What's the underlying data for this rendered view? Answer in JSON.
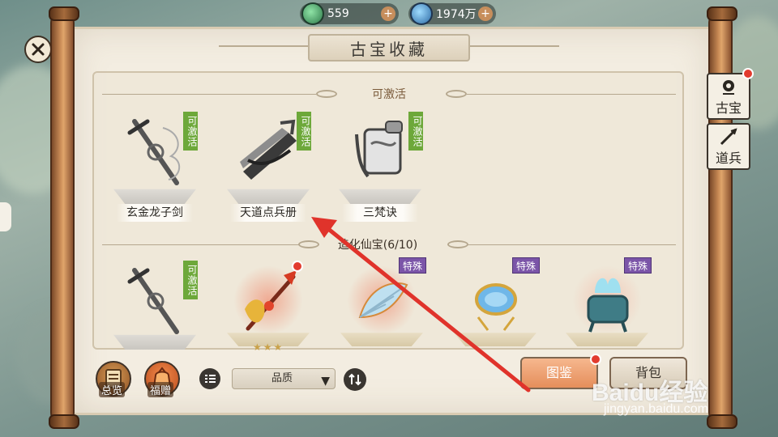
{
  "currency": {
    "jade": {
      "value": "559",
      "icon": "jade-coin-icon"
    },
    "spirit": {
      "value": "1974万",
      "icon": "spirit-stone-icon"
    }
  },
  "panel": {
    "title": "古宝收藏"
  },
  "sections": {
    "activatable": {
      "title": "可激活",
      "items": [
        {
          "name": "玄金龙子剑",
          "tag": "可激活"
        },
        {
          "name": "天道点兵册",
          "tag": "可激活"
        },
        {
          "name": "三梵诀",
          "tag": "可激活"
        }
      ]
    },
    "creation": {
      "title": "造化仙宝(6/10)",
      "items": [
        {
          "tag": "可激活",
          "tag_type": "activatable"
        },
        {
          "tag": "",
          "tag_type": "none",
          "red_dot": true,
          "stars": "★★★"
        },
        {
          "tag": "特殊",
          "tag_type": "special"
        },
        {
          "tag": "特殊",
          "tag_type": "special"
        },
        {
          "tag": "特殊",
          "tag_type": "special"
        }
      ]
    }
  },
  "side_tabs": [
    {
      "label": "古宝",
      "icon": "treasure-icon",
      "red_dot": true,
      "active": true
    },
    {
      "label": "道兵",
      "icon": "weapon-icon",
      "red_dot": false,
      "active": false
    }
  ],
  "bottom": {
    "overview_label": "总览",
    "gift_label": "福赠",
    "quality_select": "品质",
    "atlas_label": "图鉴",
    "bag_label": "背包"
  },
  "watermark": {
    "main": "Baidu经验",
    "sub": "jingyan.baidu.com"
  },
  "colors": {
    "tag_green": "#6da83a",
    "tag_purple": "#7b55a8",
    "red_dot": "#e23b2e",
    "annotation_arrow": "#e0332b"
  }
}
